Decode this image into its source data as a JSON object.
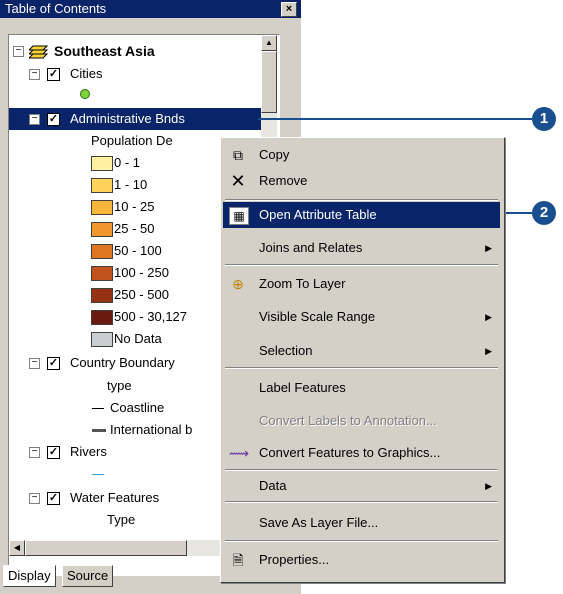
{
  "toc": {
    "title": "Table of Contents",
    "close_glyph": "×",
    "tree": {
      "root": "Southeast Asia",
      "cities": "Cities",
      "admin": "Administrative Bnds",
      "pop_field": "Population De",
      "legend": [
        "0 - 1",
        "1 - 10",
        "10 - 25",
        "25 - 50",
        "50 - 100",
        "100 - 250",
        "250 - 500",
        "500 - 30,127",
        "No Data"
      ],
      "legend_colors": [
        "#fff1a0",
        "#ffd35c",
        "#f7b63a",
        "#f0962e",
        "#df7622",
        "#c0541c",
        "#963214",
        "#6a1a0e",
        "#c9cfd0"
      ],
      "country": "Country Boundary",
      "type_lower": "type",
      "coastline": "Coastline",
      "international": "International b",
      "rivers": "Rivers",
      "water": "Water Features",
      "type_upper": "Type"
    },
    "tabs": {
      "display": "Display",
      "source": "Source"
    }
  },
  "menu": {
    "copy": "Copy",
    "remove": "Remove",
    "open_attr": "Open Attribute Table",
    "joins": "Joins and Relates",
    "zoom": "Zoom To Layer",
    "visible_scale": "Visible Scale Range",
    "selection": "Selection",
    "label": "Label Features",
    "convert_labels": "Convert Labels to Annotation...",
    "convert_features": "Convert Features to Graphics...",
    "data": "Data",
    "save_layer": "Save As Layer File...",
    "properties": "Properties..."
  },
  "callouts": {
    "one": "1",
    "two": "2"
  },
  "colors": {
    "highlight": "#0a246a",
    "callout": "#1a4f8f"
  }
}
